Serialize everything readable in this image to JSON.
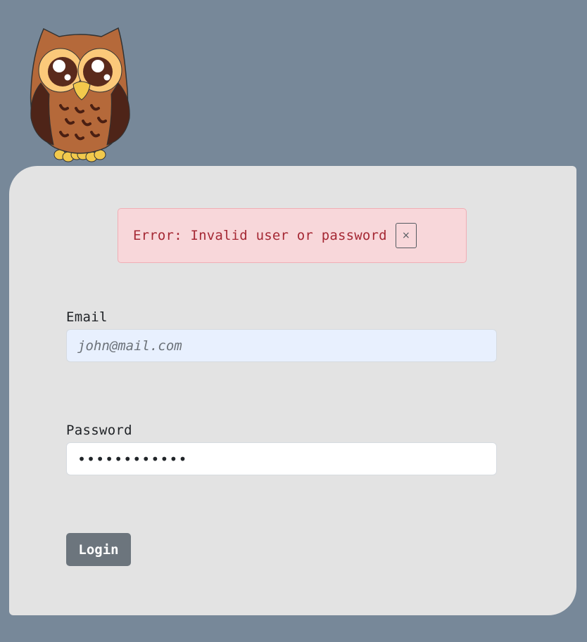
{
  "logo": {
    "icon": "owl-icon"
  },
  "alert": {
    "message": "Error: Invalid user or password",
    "close_symbol": "×",
    "close_icon": "close-icon"
  },
  "form": {
    "email": {
      "label": "Email",
      "value": "",
      "placeholder": "john@mail.com"
    },
    "password": {
      "label": "Password",
      "value": "••••••••••••"
    },
    "login_label": "Login"
  },
  "colors": {
    "page_background": "#778899",
    "card_background": "#e3e3e3",
    "alert_background": "#f8d7da",
    "alert_text": "#a52834",
    "button_background": "#6c757d",
    "email_autofill_background": "#e8f0fe"
  }
}
